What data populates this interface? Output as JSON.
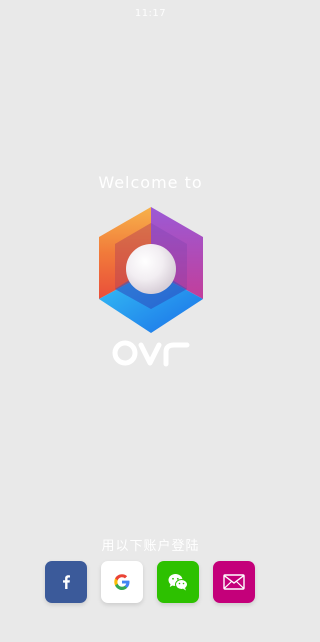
{
  "status_bar": {
    "time": "11:17"
  },
  "hero": {
    "welcome_text": "Welcome to",
    "wordmark": "OVR"
  },
  "login": {
    "hint": "用以下账户登陆",
    "providers": [
      {
        "name": "facebook",
        "color": "#3b5a9a",
        "icon": "facebook-f-icon"
      },
      {
        "name": "google",
        "color": "#ffffff",
        "icon": "google-g-icon"
      },
      {
        "name": "wechat",
        "color": "#2dc100",
        "icon": "wechat-icon"
      },
      {
        "name": "email",
        "color": "#c4007a",
        "icon": "envelope-icon"
      }
    ]
  }
}
